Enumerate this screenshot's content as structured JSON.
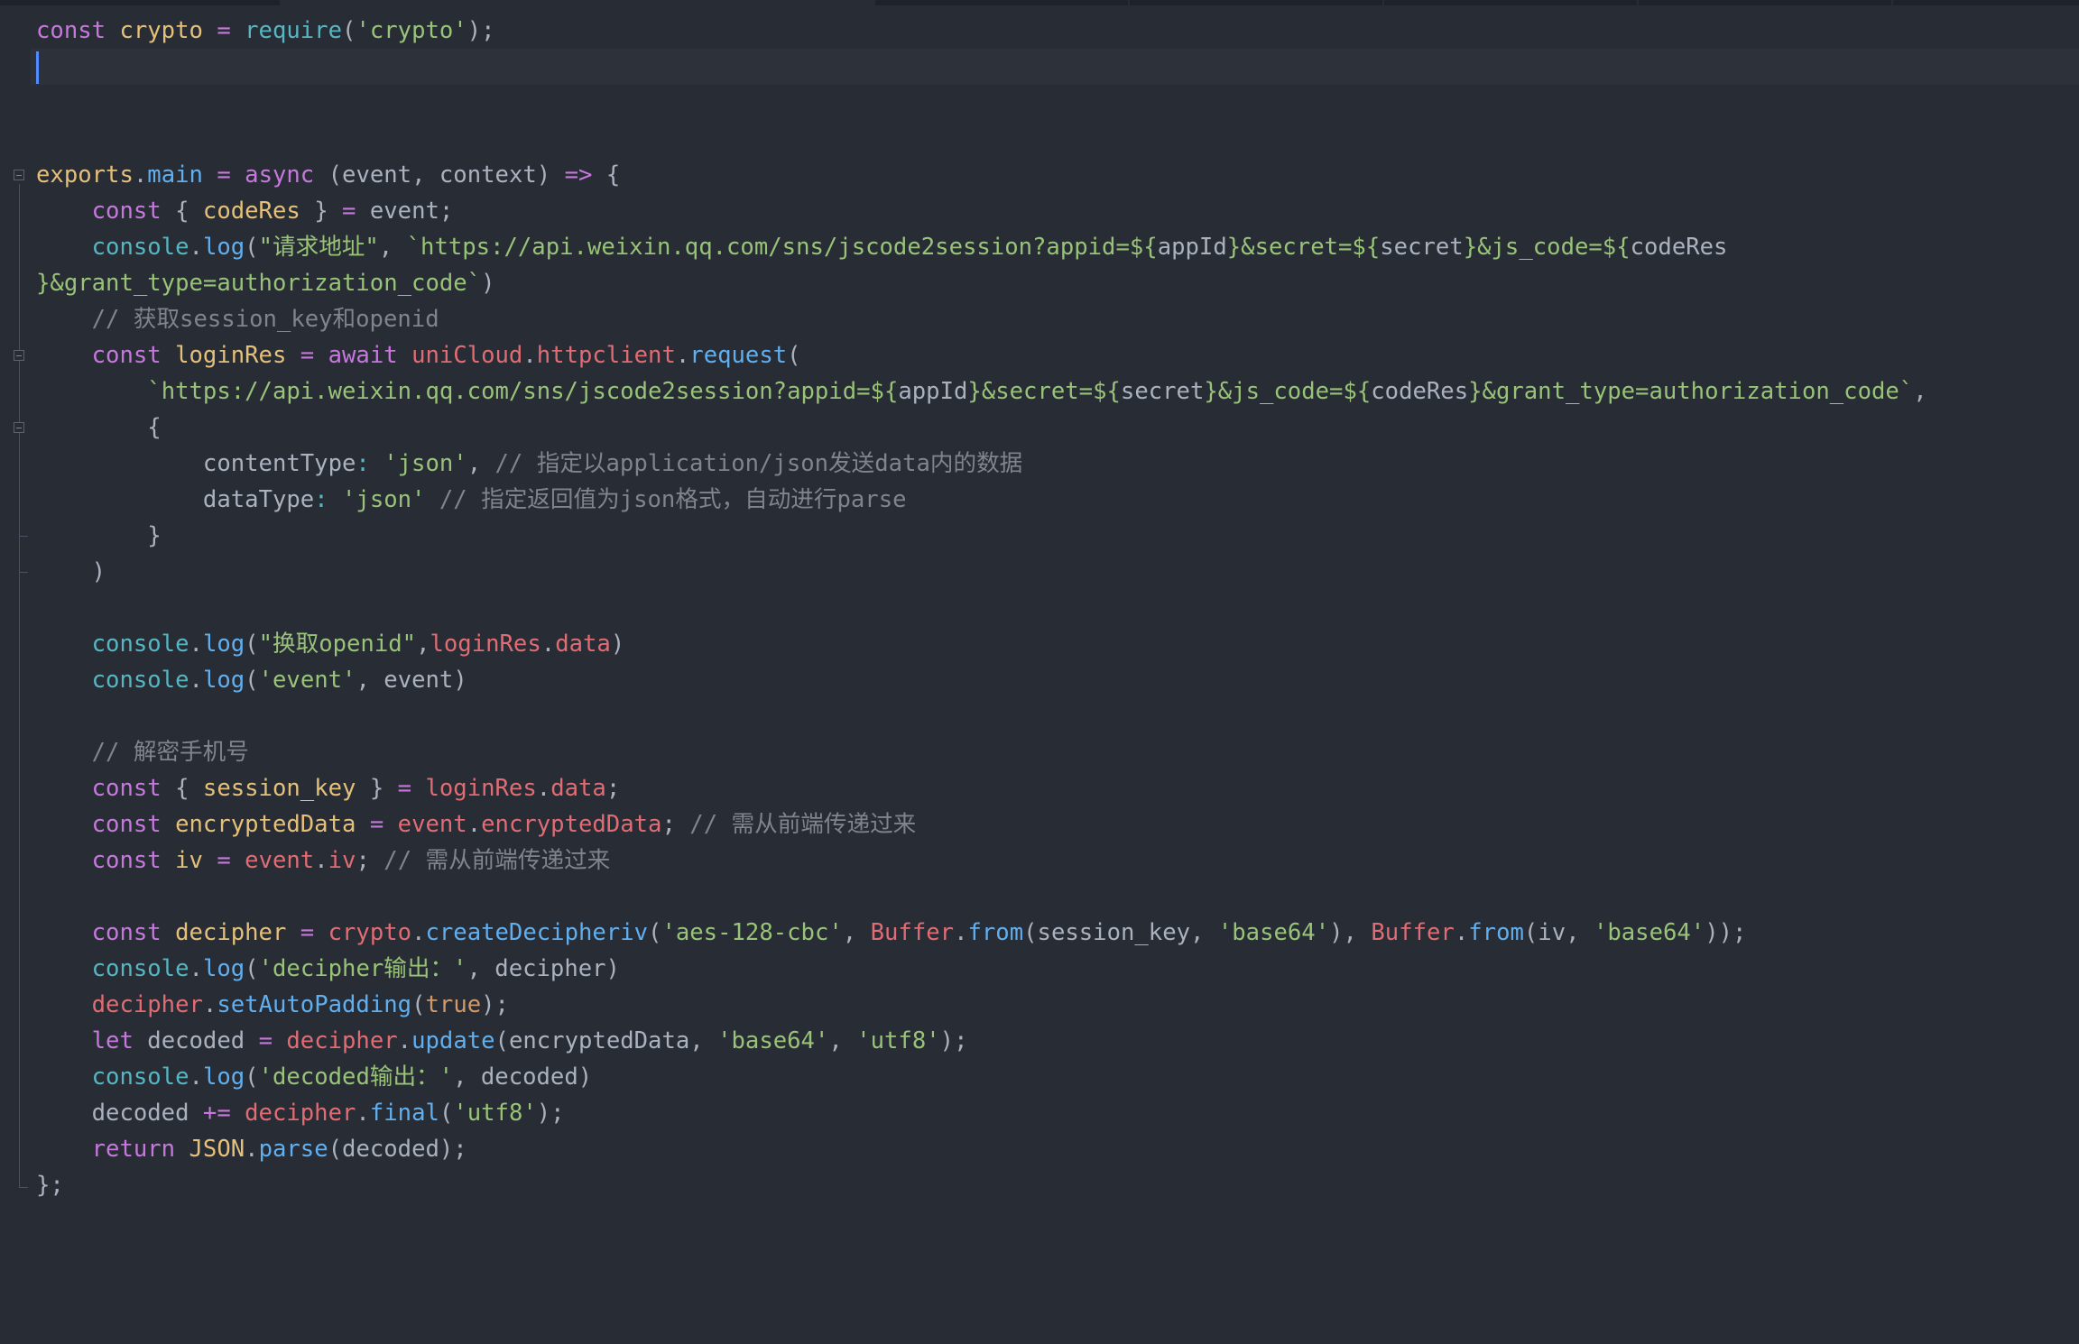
{
  "editor": {
    "language": "javascript",
    "theme_colors": {
      "background": "#282c34",
      "active_line": "#2c313a",
      "caret": "#528bff",
      "keyword": "#c678dd",
      "string": "#98c379",
      "comment": "#7f848e",
      "function": "#61afef",
      "property": "#e06c75",
      "variable": "#e5c07b",
      "builtin": "#56b6c2"
    },
    "active_line": 2,
    "fold_markers": [
      5,
      10,
      12
    ]
  },
  "code": {
    "lines": [
      [
        [
          "kw",
          "const "
        ],
        [
          "var",
          "crypto"
        ],
        [
          "op",
          " = "
        ],
        [
          "obj",
          "require"
        ],
        [
          "pl",
          "("
        ],
        [
          "str",
          "'crypto'"
        ],
        [
          "pl",
          ");"
        ]
      ],
      [],
      [],
      [],
      [
        [
          "var",
          "exports"
        ],
        [
          "pl",
          "."
        ],
        [
          "fn",
          "main"
        ],
        [
          "op",
          " = "
        ],
        [
          "kw",
          "async "
        ],
        [
          "pl",
          "(event, context) "
        ],
        [
          "op",
          "=> "
        ],
        [
          "pl",
          "{"
        ]
      ],
      [
        [
          "pl",
          "    "
        ],
        [
          "kw",
          "const "
        ],
        [
          "pl",
          "{ "
        ],
        [
          "var",
          "codeRes"
        ],
        [
          "pl",
          " } "
        ],
        [
          "op",
          "= "
        ],
        [
          "pl",
          "event;"
        ]
      ],
      [
        [
          "pl",
          "    "
        ],
        [
          "obj",
          "console"
        ],
        [
          "pl",
          "."
        ],
        [
          "fn",
          "log"
        ],
        [
          "pl",
          "("
        ],
        [
          "str",
          "\"请求地址\""
        ],
        [
          "pl",
          ", "
        ],
        [
          "str",
          "`https://api.weixin.qq.com/sns/jscode2session?appid=${"
        ],
        [
          "pl",
          "appId"
        ],
        [
          "str",
          "}&secret=${"
        ],
        [
          "pl",
          "secret"
        ],
        [
          "str",
          "}&js_code=${"
        ],
        [
          "pl",
          "codeRes"
        ]
      ],
      [
        [
          "str",
          "}&grant_type=authorization_code`"
        ],
        [
          "pl",
          ")"
        ]
      ],
      [
        [
          "pl",
          "    "
        ],
        [
          "cmt",
          "// 获取session_key和openid"
        ]
      ],
      [
        [
          "pl",
          "    "
        ],
        [
          "kw",
          "const "
        ],
        [
          "var",
          "loginRes"
        ],
        [
          "op",
          " = "
        ],
        [
          "kw",
          "await "
        ],
        [
          "prop",
          "uniCloud"
        ],
        [
          "pl",
          "."
        ],
        [
          "prop",
          "httpclient"
        ],
        [
          "pl",
          "."
        ],
        [
          "fn",
          "request"
        ],
        [
          "pl",
          "("
        ]
      ],
      [
        [
          "pl",
          "        "
        ],
        [
          "str",
          "`https://api.weixin.qq.com/sns/jscode2session?appid=${"
        ],
        [
          "pl",
          "appId"
        ],
        [
          "str",
          "}&secret=${"
        ],
        [
          "pl",
          "secret"
        ],
        [
          "str",
          "}&js_code=${"
        ],
        [
          "pl",
          "codeRes"
        ],
        [
          "str",
          "}&grant_type=authorization_code`"
        ],
        [
          "pl",
          ","
        ]
      ],
      [
        [
          "pl",
          "        {"
        ]
      ],
      [
        [
          "pl",
          "            contentType"
        ],
        [
          "obj",
          ": "
        ],
        [
          "str",
          "'json'"
        ],
        [
          "pl",
          ", "
        ],
        [
          "cmt",
          "// 指定以application/json发送data内的数据"
        ]
      ],
      [
        [
          "pl",
          "            dataType"
        ],
        [
          "obj",
          ": "
        ],
        [
          "str",
          "'json'"
        ],
        [
          "pl",
          " "
        ],
        [
          "cmt",
          "// 指定返回值为json格式，自动进行parse"
        ]
      ],
      [
        [
          "pl",
          "        }"
        ]
      ],
      [
        [
          "pl",
          "    )"
        ]
      ],
      [],
      [
        [
          "pl",
          "    "
        ],
        [
          "obj",
          "console"
        ],
        [
          "pl",
          "."
        ],
        [
          "fn",
          "log"
        ],
        [
          "pl",
          "("
        ],
        [
          "str",
          "\"换取openid\""
        ],
        [
          "pl",
          ","
        ],
        [
          "prop",
          "loginRes"
        ],
        [
          "pl",
          "."
        ],
        [
          "prop",
          "data"
        ],
        [
          "pl",
          ")"
        ]
      ],
      [
        [
          "pl",
          "    "
        ],
        [
          "obj",
          "console"
        ],
        [
          "pl",
          "."
        ],
        [
          "fn",
          "log"
        ],
        [
          "pl",
          "("
        ],
        [
          "str",
          "'event'"
        ],
        [
          "pl",
          ", event)"
        ]
      ],
      [],
      [
        [
          "pl",
          "    "
        ],
        [
          "cmt",
          "// 解密手机号"
        ]
      ],
      [
        [
          "pl",
          "    "
        ],
        [
          "kw",
          "const "
        ],
        [
          "pl",
          "{ "
        ],
        [
          "var",
          "session_key"
        ],
        [
          "pl",
          " } "
        ],
        [
          "op",
          "= "
        ],
        [
          "prop",
          "loginRes"
        ],
        [
          "pl",
          "."
        ],
        [
          "prop",
          "data"
        ],
        [
          "pl",
          ";"
        ]
      ],
      [
        [
          "pl",
          "    "
        ],
        [
          "kw",
          "const "
        ],
        [
          "var",
          "encryptedData"
        ],
        [
          "op",
          " = "
        ],
        [
          "prop",
          "event"
        ],
        [
          "pl",
          "."
        ],
        [
          "prop",
          "encryptedData"
        ],
        [
          "pl",
          "; "
        ],
        [
          "cmt",
          "// 需从前端传递过来"
        ]
      ],
      [
        [
          "pl",
          "    "
        ],
        [
          "kw",
          "const "
        ],
        [
          "var",
          "iv"
        ],
        [
          "op",
          " = "
        ],
        [
          "prop",
          "event"
        ],
        [
          "pl",
          "."
        ],
        [
          "prop",
          "iv"
        ],
        [
          "pl",
          "; "
        ],
        [
          "cmt",
          "// 需从前端传递过来"
        ]
      ],
      [],
      [
        [
          "pl",
          "    "
        ],
        [
          "kw",
          "const "
        ],
        [
          "var",
          "decipher"
        ],
        [
          "op",
          " = "
        ],
        [
          "prop",
          "crypto"
        ],
        [
          "pl",
          "."
        ],
        [
          "fn",
          "createDecipheriv"
        ],
        [
          "pl",
          "("
        ],
        [
          "str",
          "'aes-128-cbc'"
        ],
        [
          "pl",
          ", "
        ],
        [
          "prop",
          "Buffer"
        ],
        [
          "pl",
          "."
        ],
        [
          "fn",
          "from"
        ],
        [
          "pl",
          "(session_key, "
        ],
        [
          "str",
          "'base64'"
        ],
        [
          "pl",
          "), "
        ],
        [
          "prop",
          "Buffer"
        ],
        [
          "pl",
          "."
        ],
        [
          "fn",
          "from"
        ],
        [
          "pl",
          "(iv, "
        ],
        [
          "str",
          "'base64'"
        ],
        [
          "pl",
          "));"
        ]
      ],
      [
        [
          "pl",
          "    "
        ],
        [
          "obj",
          "console"
        ],
        [
          "pl",
          "."
        ],
        [
          "fn",
          "log"
        ],
        [
          "pl",
          "("
        ],
        [
          "str",
          "'decipher输出：'"
        ],
        [
          "pl",
          ", decipher)"
        ]
      ],
      [
        [
          "pl",
          "    "
        ],
        [
          "prop",
          "decipher"
        ],
        [
          "pl",
          "."
        ],
        [
          "fn",
          "setAutoPadding"
        ],
        [
          "pl",
          "("
        ],
        [
          "bool",
          "true"
        ],
        [
          "pl",
          ");"
        ]
      ],
      [
        [
          "pl",
          "    "
        ],
        [
          "kw",
          "let "
        ],
        [
          "pl",
          "decoded "
        ],
        [
          "op",
          "= "
        ],
        [
          "prop",
          "decipher"
        ],
        [
          "pl",
          "."
        ],
        [
          "fn",
          "update"
        ],
        [
          "pl",
          "(encryptedData, "
        ],
        [
          "str",
          "'base64'"
        ],
        [
          "pl",
          ", "
        ],
        [
          "str",
          "'utf8'"
        ],
        [
          "pl",
          ");"
        ]
      ],
      [
        [
          "pl",
          "    "
        ],
        [
          "obj",
          "console"
        ],
        [
          "pl",
          "."
        ],
        [
          "fn",
          "log"
        ],
        [
          "pl",
          "("
        ],
        [
          "str",
          "'decoded输出：'"
        ],
        [
          "pl",
          ", decoded)"
        ]
      ],
      [
        [
          "pl",
          "    decoded "
        ],
        [
          "op",
          "+= "
        ],
        [
          "prop",
          "decipher"
        ],
        [
          "pl",
          "."
        ],
        [
          "fn",
          "final"
        ],
        [
          "pl",
          "("
        ],
        [
          "str",
          "'utf8'"
        ],
        [
          "pl",
          ");"
        ]
      ],
      [
        [
          "pl",
          "    "
        ],
        [
          "kw",
          "return "
        ],
        [
          "var",
          "JSON"
        ],
        [
          "pl",
          "."
        ],
        [
          "fn",
          "parse"
        ],
        [
          "pl",
          "(decoded);"
        ]
      ],
      [
        [
          "pl",
          "};"
        ]
      ]
    ]
  }
}
